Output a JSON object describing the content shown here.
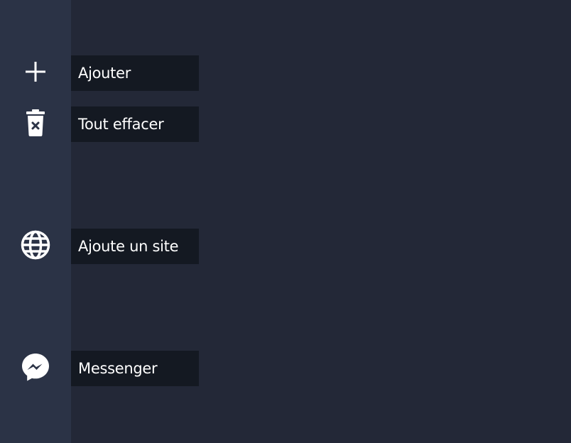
{
  "sidebar": {
    "items": [
      {
        "icon": "plus-icon",
        "tooltip": "Ajouter"
      },
      {
        "icon": "trash-icon",
        "tooltip": "Tout effacer"
      },
      {
        "icon": "globe-icon",
        "tooltip": "Ajoute un site"
      },
      {
        "icon": "messenger-icon",
        "tooltip": "Messenger"
      }
    ]
  },
  "colors": {
    "background": "#232837",
    "sidebar": "#2b3346",
    "tooltip_bg": "#141922",
    "text": "#ffffff"
  }
}
